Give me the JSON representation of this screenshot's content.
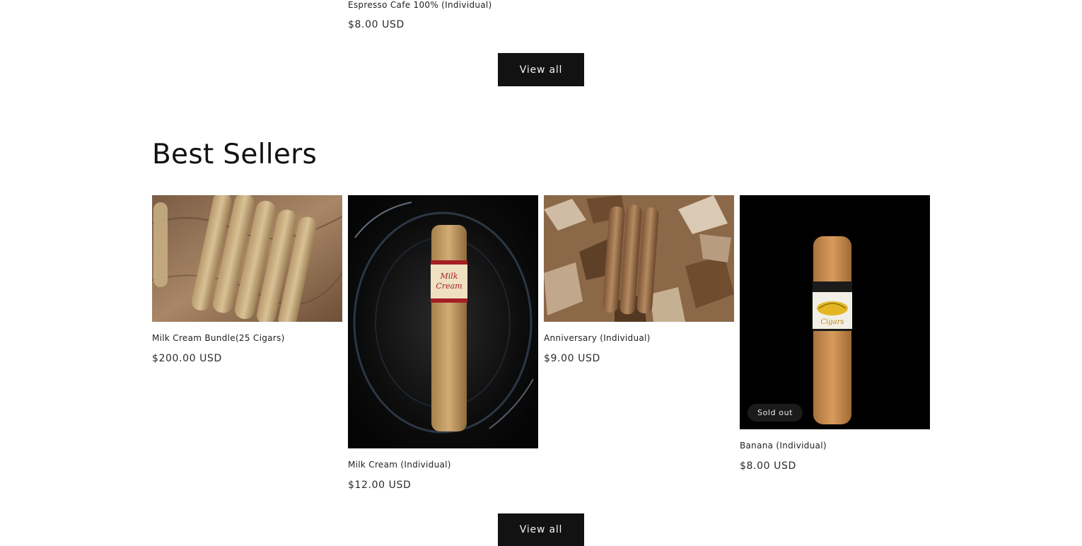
{
  "prev_section": {
    "product": {
      "title": "Espresso Cafe 100% (Individual)",
      "price": "$8.00 USD"
    },
    "view_all_label": "View all"
  },
  "best_sellers": {
    "heading": "Best Sellers",
    "products": [
      {
        "title": "Milk Cream Bundle(25 Cigars)",
        "price": "$200.00 USD"
      },
      {
        "title": "Milk Cream (Individual)",
        "price": "$12.00 USD",
        "band_text": "Milk Cream"
      },
      {
        "title": "Anniversary (Individual)",
        "price": "$9.00 USD"
      },
      {
        "title": "Banana (Individual)",
        "price": "$8.00 USD",
        "badge": "Sold out",
        "band_text": "Cigars"
      }
    ],
    "view_all_label": "View all"
  },
  "colors": {
    "button_bg": "#121212",
    "button_text": "#f3f3f3",
    "badge_bg": "#1b1b1b"
  }
}
